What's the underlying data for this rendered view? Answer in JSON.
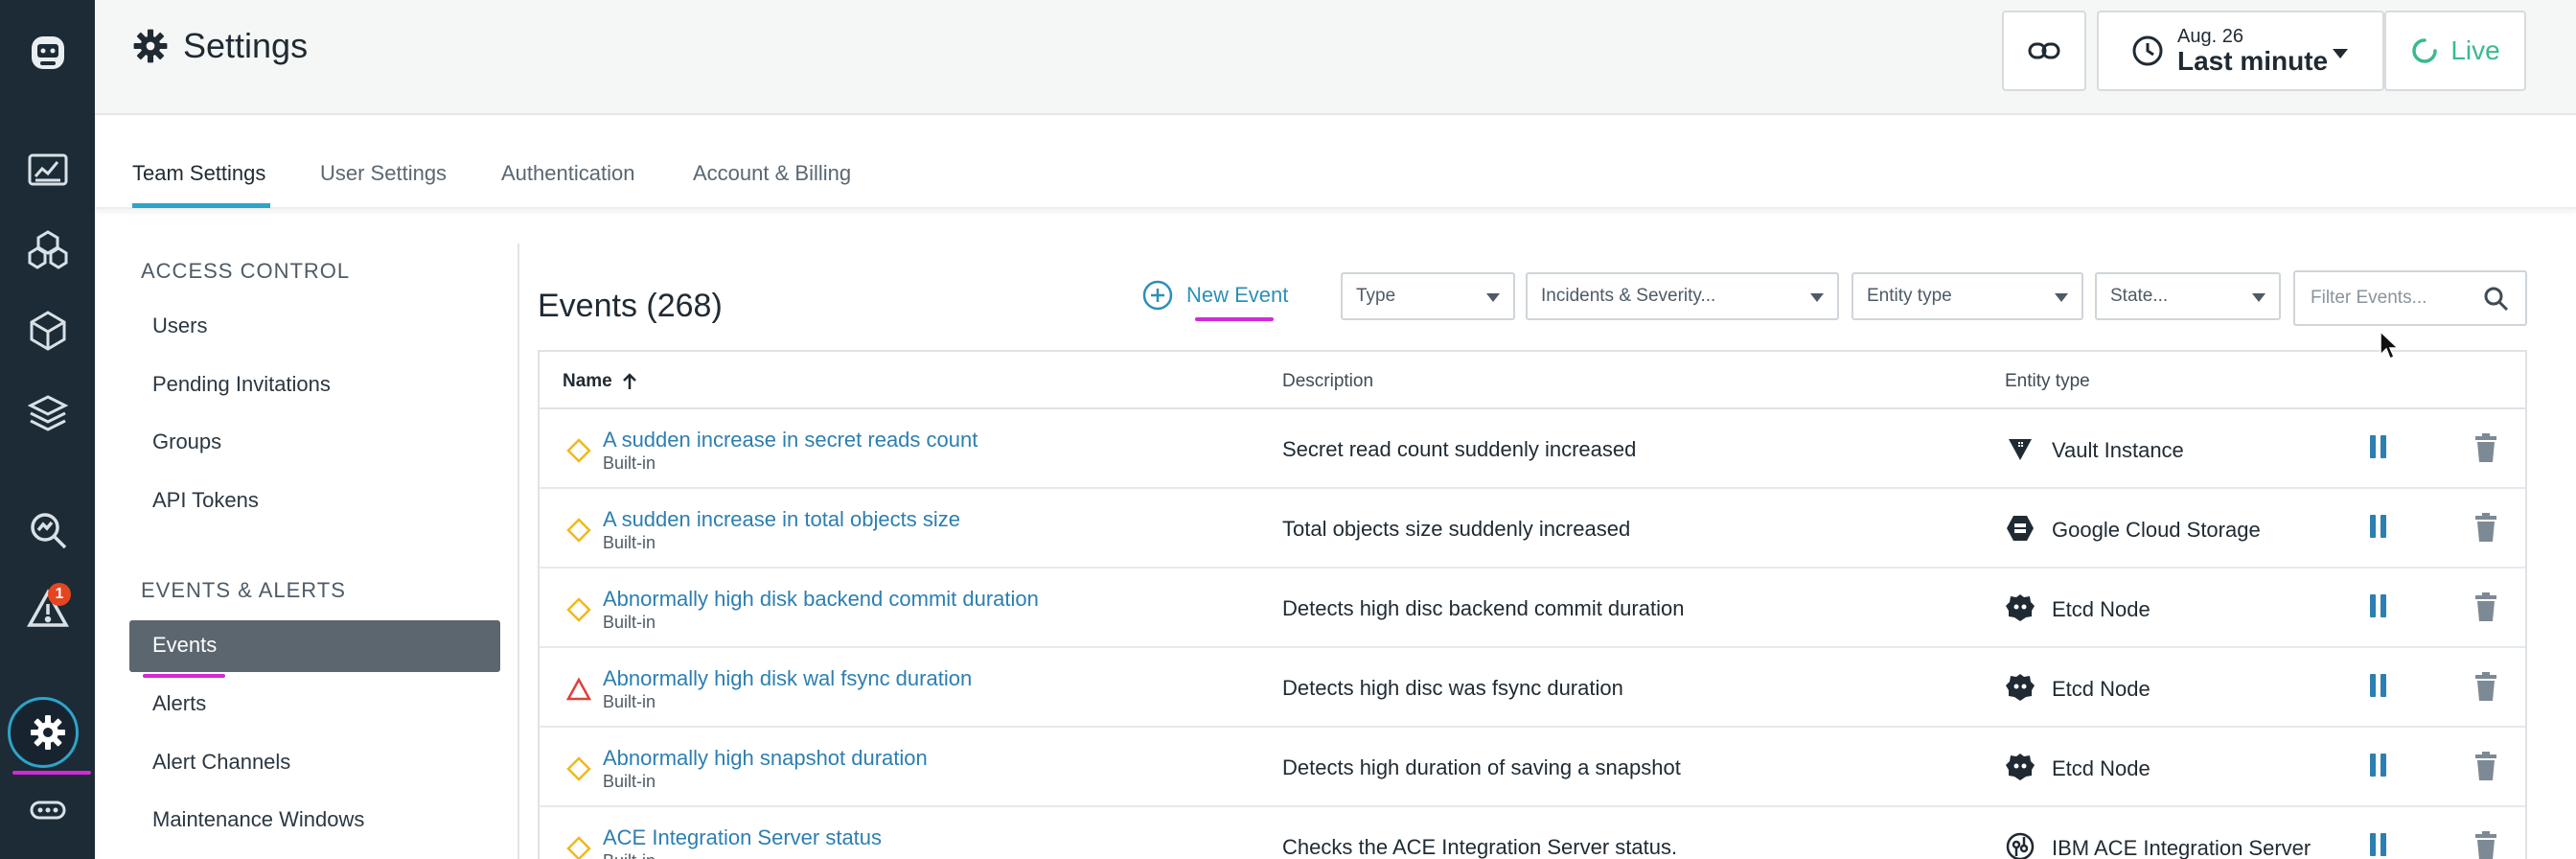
{
  "header": {
    "title": "Settings",
    "time_date": "Aug. 26",
    "time_range": "Last minute",
    "live_label": "Live"
  },
  "rail": {
    "alerts_badge": "1"
  },
  "tabs": [
    {
      "label": "Team Settings",
      "active": true
    },
    {
      "label": "User Settings",
      "active": false
    },
    {
      "label": "Authentication",
      "active": false
    },
    {
      "label": "Account & Billing",
      "active": false
    }
  ],
  "sidebar": {
    "access_control_heading": "ACCESS CONTROL",
    "access_items": [
      "Users",
      "Pending Invitations",
      "Groups",
      "API Tokens"
    ],
    "events_heading": "EVENTS & ALERTS",
    "events_items": [
      "Events",
      "Alerts",
      "Alert Channels",
      "Maintenance Windows"
    ],
    "active_item": "Events"
  },
  "main": {
    "title": "Events (268)",
    "new_event_label": "New Event",
    "filters": {
      "type": "Type",
      "incidents": "Incidents & Severity...",
      "entity_type": "Entity type",
      "state": "State...",
      "search_placeholder": "Filter Events..."
    },
    "columns": {
      "name": "Name",
      "description": "Description",
      "entity_type": "Entity type"
    },
    "rows": [
      {
        "name": "A sudden increase in secret reads count",
        "sub": "Built-in",
        "description": "Secret read count suddenly increased",
        "entity": "Vault Instance",
        "severity": "warning",
        "entity_icon": "vault-icon"
      },
      {
        "name": "A sudden increase in total objects size",
        "sub": "Built-in",
        "description": "Total objects size suddenly increased",
        "entity": "Google Cloud Storage",
        "severity": "warning",
        "entity_icon": "gcs-icon"
      },
      {
        "name": "Abnormally high disk backend commit duration",
        "sub": "Built-in",
        "description": "Detects high disc backend commit duration",
        "entity": "Etcd Node",
        "severity": "warning",
        "entity_icon": "etcd-icon"
      },
      {
        "name": "Abnormally high disk wal fsync duration",
        "sub": "Built-in",
        "description": "Detects high disc was fsync duration",
        "entity": "Etcd Node",
        "severity": "critical",
        "entity_icon": "etcd-icon"
      },
      {
        "name": "Abnormally high snapshot duration",
        "sub": "Built-in",
        "description": "Detects high duration of saving a snapshot",
        "entity": "Etcd Node",
        "severity": "warning",
        "entity_icon": "etcd-icon"
      },
      {
        "name": "ACE Integration Server status",
        "sub": "Built-in",
        "description": "Checks the ACE Integration Server status.",
        "entity": "IBM ACE Integration Server",
        "severity": "warning",
        "entity_icon": "ibm-ace-icon"
      }
    ]
  },
  "colors": {
    "rail_bg": "#1c2b36",
    "accent": "#2fa3c8",
    "link": "#2c7fb0",
    "live": "#3bb98f",
    "warning": "#f2b81a",
    "critical": "#e0403b",
    "highlight": "#d22ad8"
  }
}
